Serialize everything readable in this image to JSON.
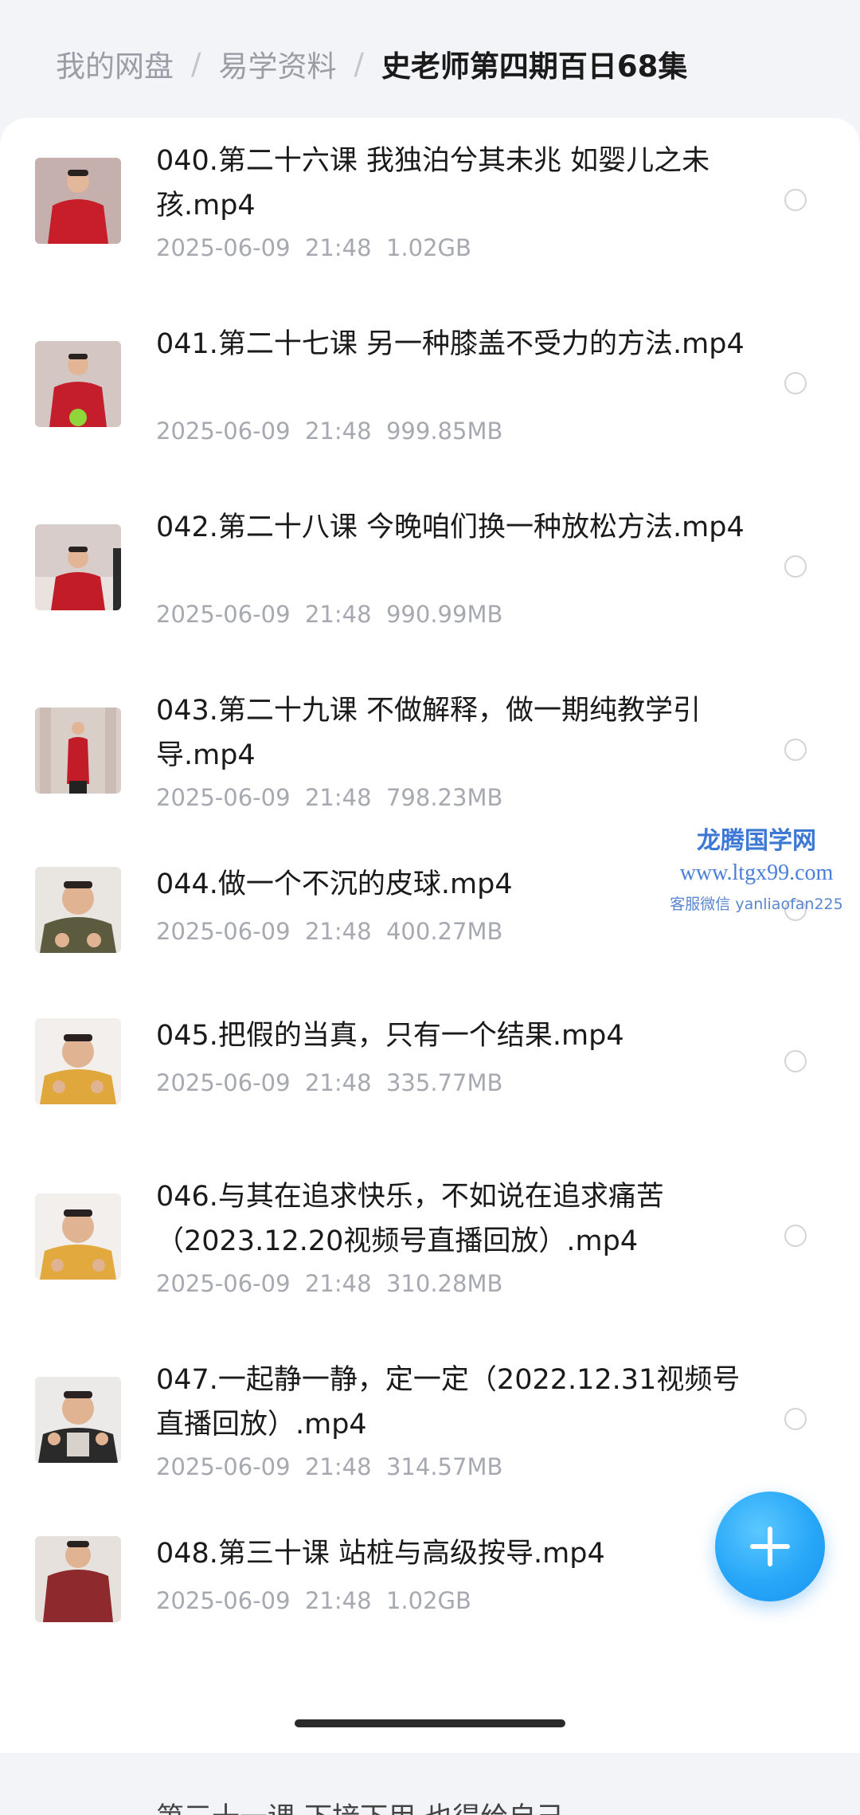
{
  "breadcrumb": {
    "items": [
      "我的网盘",
      "易学资料",
      "史老师第四期百日68集"
    ],
    "separator": "/"
  },
  "files": [
    {
      "name": "040.第二十六课  我独泊兮其未兆  如婴儿之未孩.mp4",
      "date": "2025-06-09  21:48",
      "size": "1.02GB"
    },
    {
      "name": "041.第二十七课  另一种膝盖不受力的方法.mp4",
      "date": "2025-06-09  21:48",
      "size": "999.85MB"
    },
    {
      "name": "042.第二十八课  今晚咱们换一种放松方法.mp4",
      "date": "2025-06-09  21:48",
      "size": "990.99MB"
    },
    {
      "name": "043.第二十九课  不做解释，做一期纯教学引导.mp4",
      "date": "2025-06-09  21:48",
      "size": "798.23MB"
    },
    {
      "name": "044.做一个不沉的皮球.mp4",
      "date": "2025-06-09  21:48",
      "size": "400.27MB"
    },
    {
      "name": "045.把假的当真，只有一个结果.mp4",
      "date": "2025-06-09  21:48",
      "size": "335.77MB"
    },
    {
      "name": "046.与其在追求快乐，不如说在追求痛苦（2023.12.20视频号直播回放）.mp4",
      "date": "2025-06-09  21:48",
      "size": "310.28MB"
    },
    {
      "name": "047.一起静一静，定一定（2022.12.31视频号直播回放）.mp4",
      "date": "2025-06-09  21:48",
      "size": "314.57MB"
    },
    {
      "name": "048.第三十课  站桩与高级按导.mp4",
      "date": "2025-06-09  21:48",
      "size": "1.02GB"
    }
  ],
  "next_item_partial": "第三十一课  下接下用  也得给自己",
  "watermark": {
    "title": "龙腾国学网",
    "url": "www.ltgx99.com",
    "contact": "客服微信 yanliaofan225"
  },
  "icons": {
    "fab": "plus-icon"
  },
  "colors": {
    "accent": "#27a7f8",
    "background": "#f3f4f8",
    "muted_text": "#a6a9b0",
    "watermark": "#3d78d6"
  }
}
